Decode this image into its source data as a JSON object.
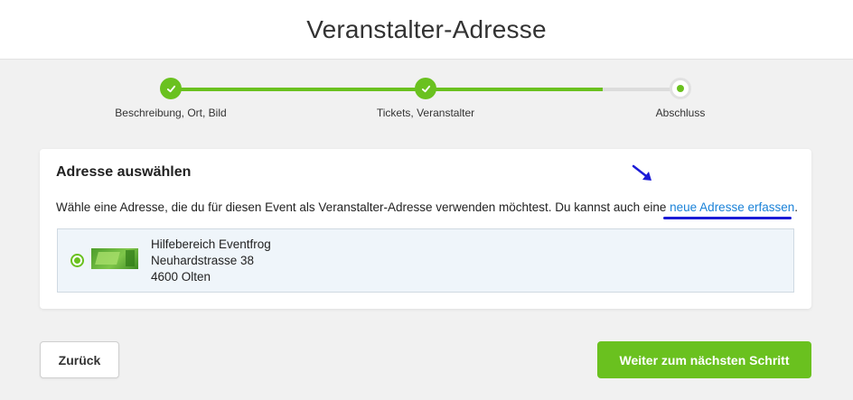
{
  "header": {
    "title": "Veranstalter-Adresse"
  },
  "stepper": {
    "progress_fraction": 0.85,
    "steps": [
      {
        "label": "Beschreibung, Ort, Bild",
        "state": "done"
      },
      {
        "label": "Tickets, Veranstalter",
        "state": "done"
      },
      {
        "label": "Abschluss",
        "state": "current"
      }
    ]
  },
  "card": {
    "title": "Adresse auswählen",
    "description": "Wähle eine Adresse, die du für diesen Event als Veranstalter-Adresse verwenden möchtest. Du kannst auch eine ",
    "link_text": "neue Adresse erfassen",
    "link_suffix": ".",
    "address": {
      "selected": true,
      "name": "Hilfebereich Eventfrog",
      "street": "Neuhardstrasse 38",
      "city": "4600 Olten"
    }
  },
  "buttons": {
    "back": "Zurück",
    "next": "Weiter zum nächsten Schritt"
  },
  "colors": {
    "accent_green": "#6ac11f",
    "link_blue": "#1a82d8",
    "annotation_blue": "#1b1bd6"
  }
}
